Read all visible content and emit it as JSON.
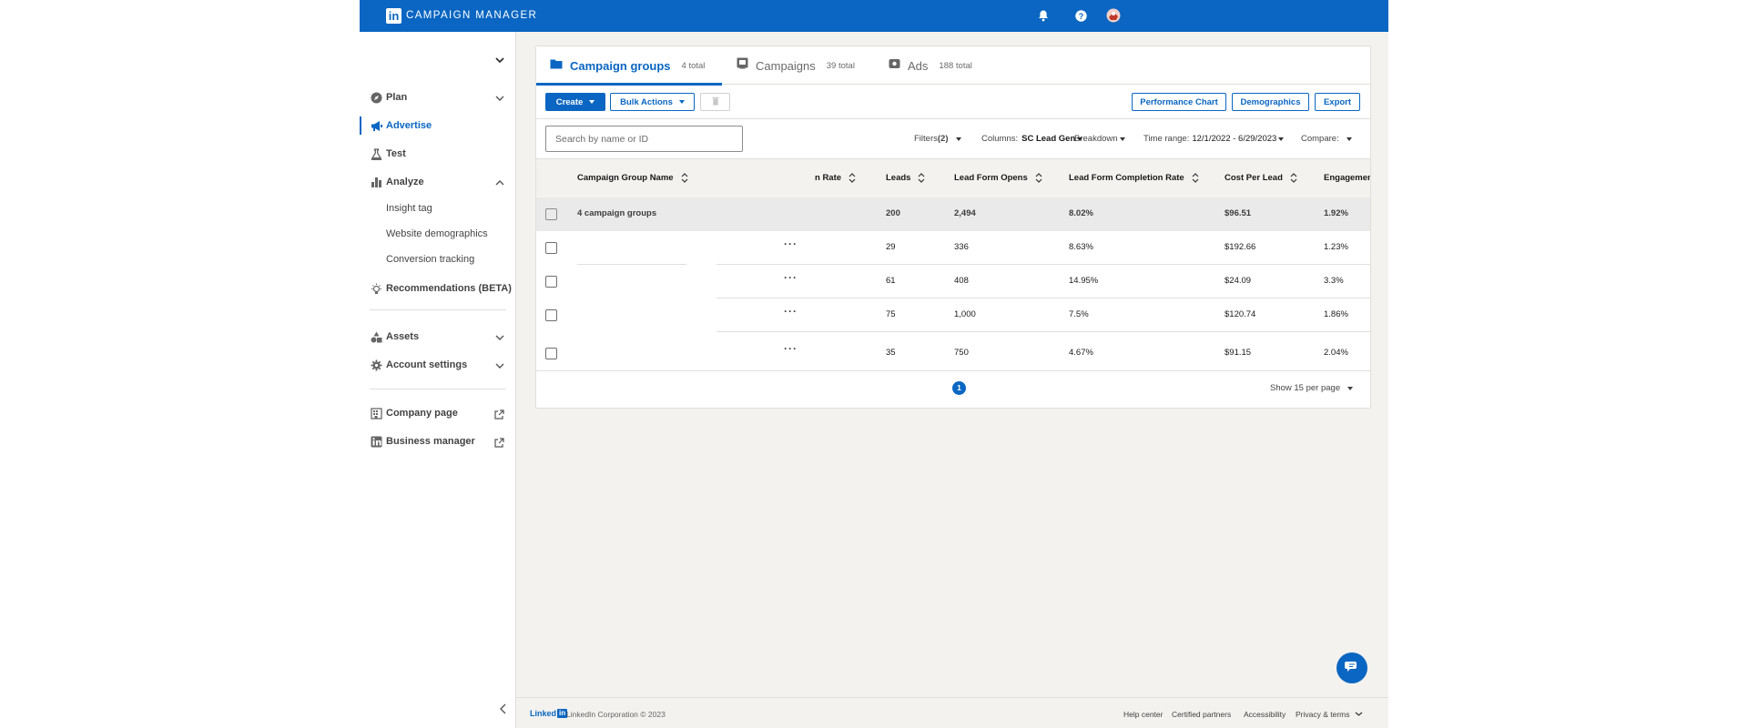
{
  "header": {
    "logo_letter": "in",
    "app_title": "CAMPAIGN MANAGER",
    "icons": [
      "bell-icon",
      "help-icon",
      "avatar"
    ]
  },
  "sidebar": {
    "items": [
      {
        "label": "Plan",
        "icon": "compass-icon",
        "expandable": true,
        "expanded": false
      },
      {
        "label": "Advertise",
        "icon": "megaphone-icon",
        "active": true
      },
      {
        "label": "Test",
        "icon": "flask-icon"
      },
      {
        "label": "Analyze",
        "icon": "bar-chart-icon",
        "expandable": true,
        "expanded": true
      },
      {
        "label": "Recommendations (BETA)",
        "icon": "lightbulb-icon"
      },
      {
        "label": "Assets",
        "icon": "shapes-icon",
        "expandable": true,
        "expanded": false
      },
      {
        "label": "Account settings",
        "icon": "gear-icon",
        "expandable": true,
        "expanded": false
      },
      {
        "label": "Company page",
        "icon": "building-icon",
        "external": true
      },
      {
        "label": "Business manager",
        "icon": "linkedin-icon",
        "external": true
      }
    ],
    "analyze_sub": [
      "Insight tag",
      "Website demographics",
      "Conversion tracking"
    ]
  },
  "tabs": [
    {
      "label": "Campaign groups",
      "count": "4 total",
      "icon": "folder-icon",
      "active": true
    },
    {
      "label": "Campaigns",
      "count": "39 total",
      "icon": "campaign-icon"
    },
    {
      "label": "Ads",
      "count": "188 total",
      "icon": "ad-icon"
    }
  ],
  "toolbar": {
    "create_label": "Create",
    "bulk_actions_label": "Bulk Actions",
    "delete_icon": "trash-icon",
    "performance_chart_label": "Performance Chart",
    "demographics_label": "Demographics",
    "export_label": "Export"
  },
  "filters": {
    "search_placeholder": "Search by name or ID",
    "filters_label": "Filters",
    "filters_count": "(2)",
    "columns_label": "Columns:",
    "columns_value": "SC Lead Gen",
    "breakdown_label": "Breakdown",
    "time_range_label": "Time range:",
    "time_range_value": "12/1/2022 - 6/29/2023",
    "compare_label": "Compare:"
  },
  "table": {
    "columns": [
      "Campaign Group Name",
      "n Rate",
      "Leads",
      "Lead Form Opens",
      "Lead Form Completion Rate",
      "Cost Per Lead",
      "Engagement"
    ],
    "total_row": {
      "name": "4 campaign groups",
      "leads": "200",
      "opens": "2,494",
      "completion": "8.02%",
      "cpl": "$96.51",
      "engagement": "1.92%"
    },
    "rows": [
      {
        "name": "",
        "leads": "29",
        "opens": "336",
        "completion": "8.63%",
        "cpl": "$192.66",
        "engagement": "1.23%"
      },
      {
        "name": "",
        "leads": "61",
        "opens": "408",
        "completion": "14.95%",
        "cpl": "$24.09",
        "engagement": "3.3%"
      },
      {
        "name": "",
        "leads": "75",
        "opens": "1,000",
        "completion": "7.5%",
        "cpl": "$120.74",
        "engagement": "1.86%"
      },
      {
        "name": "",
        "leads": "35",
        "opens": "750",
        "completion": "4.67%",
        "cpl": "$91.15",
        "engagement": "2.04%"
      }
    ],
    "more_label": "···"
  },
  "pagination": {
    "current_page": "1",
    "per_page_label": "Show 15 per page"
  },
  "footer": {
    "logo_text": "Linked",
    "logo_in": "in",
    "copyright": "LinkedIn Corporation © 2023",
    "links": [
      "Help center",
      "Certified partners",
      "Accessibility",
      "Privacy & terms"
    ]
  },
  "colors": {
    "brand": "#0a66c2",
    "background": "#f3f2ef"
  }
}
